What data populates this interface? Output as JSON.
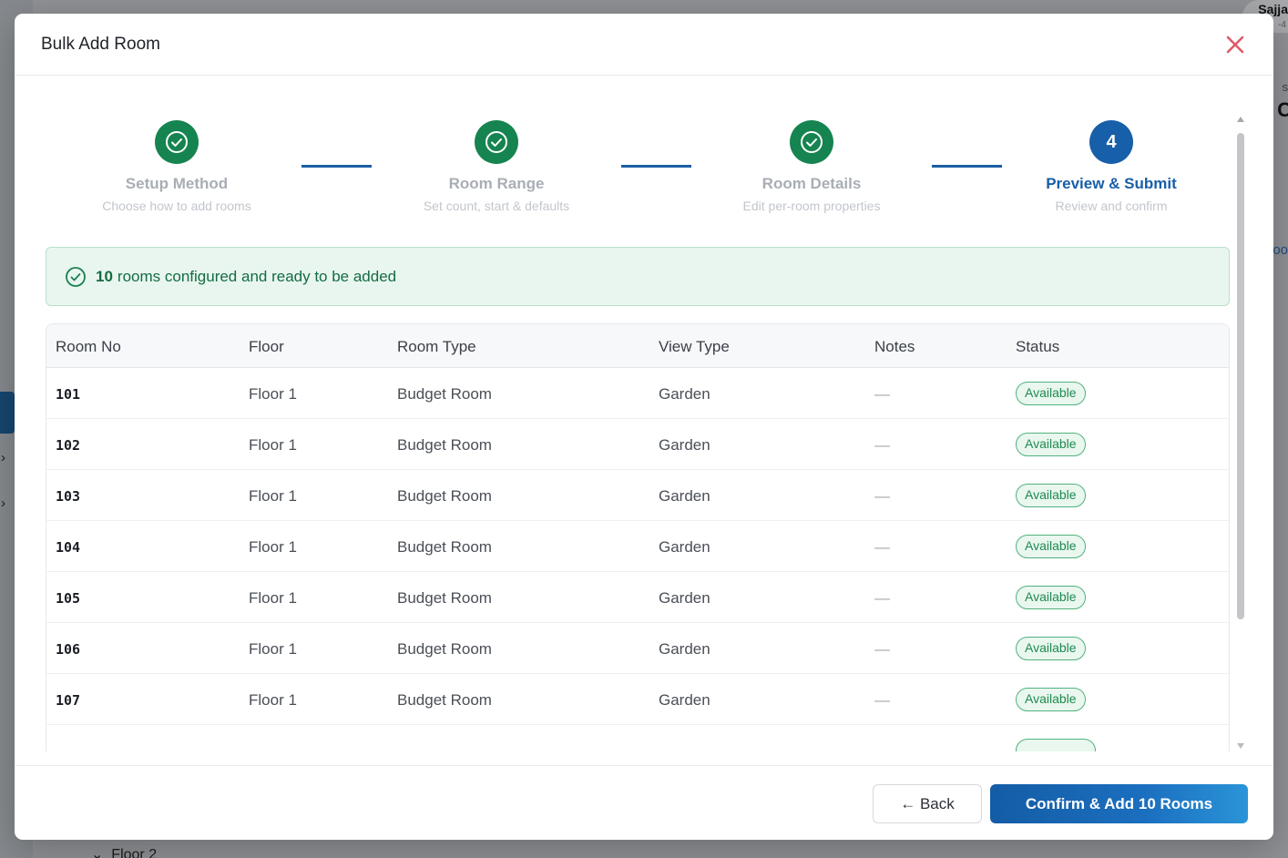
{
  "background": {
    "user_name": "Sajja",
    "user_sub": "-4",
    "right_label_1": "S",
    "right_label_2": "C",
    "right_label_3": "oo",
    "bottom_section": "Floor 2"
  },
  "modal": {
    "title": "Bulk Add Room",
    "close_icon": "close-icon"
  },
  "stepper": {
    "steps": [
      {
        "title": "Setup Method",
        "subtitle": "Choose how to add rooms",
        "state": "done"
      },
      {
        "title": "Room Range",
        "subtitle": "Set count, start & defaults",
        "state": "done"
      },
      {
        "title": "Room Details",
        "subtitle": "Edit per-room properties",
        "state": "done"
      },
      {
        "title": "Preview & Submit",
        "subtitle": "Review and confirm",
        "state": "active",
        "number": "4"
      }
    ]
  },
  "banner": {
    "count": "10",
    "text": "rooms configured and ready to be added",
    "color": "#146c43"
  },
  "table": {
    "headers": {
      "room_no": "Room No",
      "floor": "Floor",
      "room_type": "Room Type",
      "view_type": "View Type",
      "notes": "Notes",
      "status": "Status"
    },
    "rows": [
      {
        "room_no": "101",
        "floor": "Floor 1",
        "room_type": "Budget Room",
        "view_type": "Garden",
        "notes": "—",
        "status": "Available"
      },
      {
        "room_no": "102",
        "floor": "Floor 1",
        "room_type": "Budget Room",
        "view_type": "Garden",
        "notes": "—",
        "status": "Available"
      },
      {
        "room_no": "103",
        "floor": "Floor 1",
        "room_type": "Budget Room",
        "view_type": "Garden",
        "notes": "—",
        "status": "Available"
      },
      {
        "room_no": "104",
        "floor": "Floor 1",
        "room_type": "Budget Room",
        "view_type": "Garden",
        "notes": "—",
        "status": "Available"
      },
      {
        "room_no": "105",
        "floor": "Floor 1",
        "room_type": "Budget Room",
        "view_type": "Garden",
        "notes": "—",
        "status": "Available"
      },
      {
        "room_no": "106",
        "floor": "Floor 1",
        "room_type": "Budget Room",
        "view_type": "Garden",
        "notes": "—",
        "status": "Available"
      },
      {
        "room_no": "107",
        "floor": "Floor 1",
        "room_type": "Budget Room",
        "view_type": "Garden",
        "notes": "—",
        "status": "Available"
      }
    ]
  },
  "footer": {
    "back_label": "← Back",
    "confirm_label": "Confirm & Add 10 Rooms"
  },
  "colors": {
    "primary": "#175fa8",
    "success": "#168450",
    "danger": "#e05a66"
  }
}
